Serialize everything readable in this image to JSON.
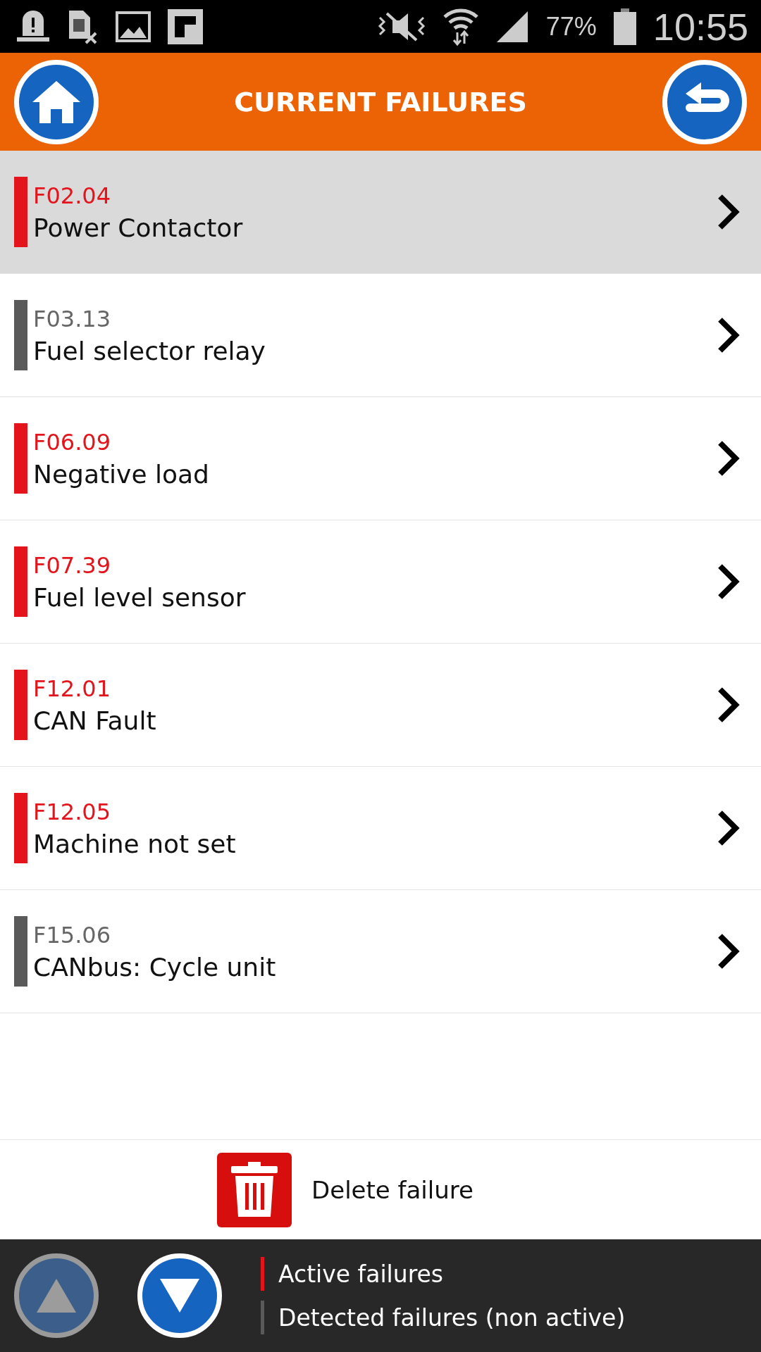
{
  "status_bar": {
    "battery": "77%",
    "time": "10:55"
  },
  "header": {
    "title": "CURRENT FAILURES"
  },
  "failures": [
    {
      "code": "F02.04",
      "name": "Power Contactor",
      "kind": "active",
      "selected": true
    },
    {
      "code": "F03.13",
      "name": "Fuel selector relay",
      "kind": "detected",
      "selected": false
    },
    {
      "code": "F06.09",
      "name": "Negative load",
      "kind": "active",
      "selected": false
    },
    {
      "code": "F07.39",
      "name": "Fuel level sensor",
      "kind": "active",
      "selected": false
    },
    {
      "code": "F12.01",
      "name": "CAN Fault",
      "kind": "active",
      "selected": false
    },
    {
      "code": "F12.05",
      "name": "Machine not set",
      "kind": "active",
      "selected": false
    },
    {
      "code": "F15.06",
      "name": "CANbus: Cycle unit",
      "kind": "detected",
      "selected": false
    }
  ],
  "delete_button": {
    "label": "Delete failure"
  },
  "footer": {
    "scroll_up": {
      "disabled": true
    },
    "scroll_down": {
      "disabled": false
    },
    "legend": [
      {
        "label": "Active failures",
        "kind": "active"
      },
      {
        "label": "Detected failures (non active)",
        "kind": "detected"
      }
    ]
  }
}
